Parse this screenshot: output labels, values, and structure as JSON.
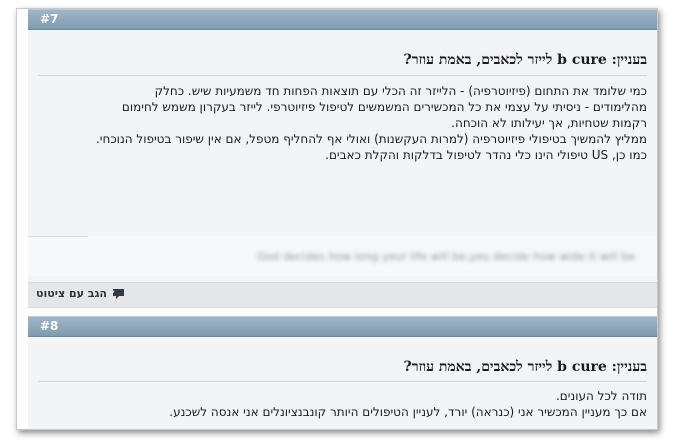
{
  "posts": [
    {
      "number": "#7",
      "title": "בעניין: b cure לייזר לכאבים, באמת עוזר?",
      "body": [
        "כמי שלומד את התחום (פיזיוטרפיה) - הלייזר זה הכלי עם תוצאות הפחות חד משמעיות שיש. כחלק",
        "מהלימודים - ניסיתי על עצמי את כל המכשירים המשמשים לטיפול פיזיוטרפי. לייזר בעקרון משמש לחימום",
        "רקמות שטחיות, אך יעילותו לא הוכחה.",
        "ממליץ להמשיך בטיפולי פיזיוטרפיה (למרות העקשנות) ואולי אף להחליף מטפל, אם אין שיפור בטיפול הנוכחי.",
        "כמו כן, US טיפולי הינו כלי נהדר לטיפול בדלקות והקלת כאבים."
      ],
      "signature": "God decides how long your life will be,you decide how wide it will be",
      "quote_label": "הגב עם ציטוט"
    },
    {
      "number": "#8",
      "title": "בעניין: b cure לייזר לכאבים, באמת עוזר?",
      "body": [
        "תודה לכל העונים.",
        "אם כך מעניין המכשיר אני (כנראה) יורד, לעניין הטיפולים היותר קונבנציונלים אני אנסה לשכנע."
      ]
    }
  ],
  "colors": {
    "header_bar": "#8aa3b7",
    "post_background": "#f3f4f6",
    "footer_bar": "#e4e6e9"
  }
}
